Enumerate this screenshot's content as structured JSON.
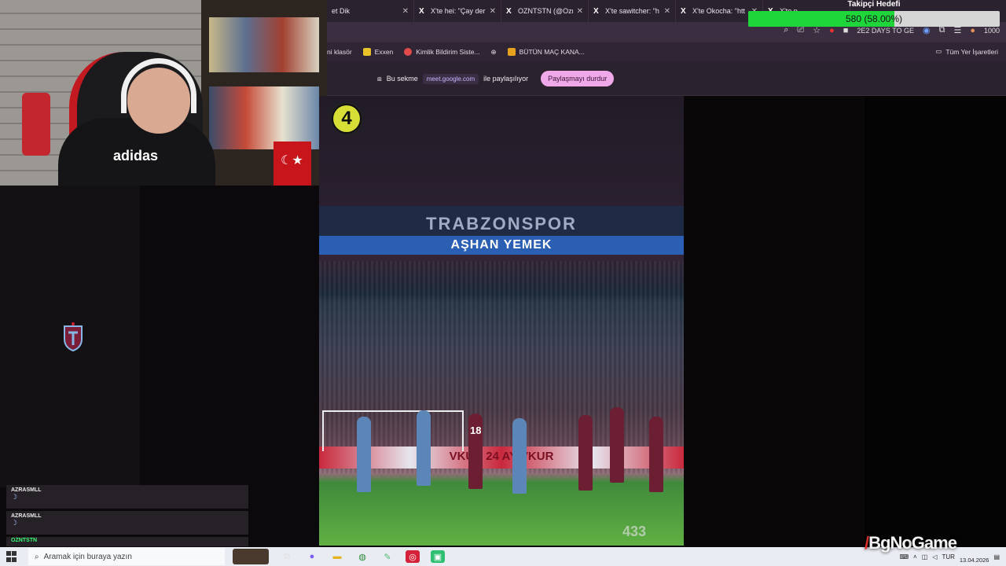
{
  "tabs": [
    {
      "label": "et Dik"
    },
    {
      "label": "X'te hei: \"Çay der"
    },
    {
      "label": "OZNTSTN (@Ozn"
    },
    {
      "label": "X'te sawitcher: \"h"
    },
    {
      "label": "X'te Okocha: \"htt"
    },
    {
      "label": "X'te p"
    }
  ],
  "toolbar": {
    "extension_text": "2E2 DAYS TO GE",
    "count": "1000"
  },
  "bookmarks": [
    {
      "label": "ni klasör"
    },
    {
      "label": "Exxen"
    },
    {
      "label": "Kimlik Bildirim Siste..."
    },
    {
      "label": ""
    },
    {
      "label": "BÜTÜN MAÇ KANA..."
    }
  ],
  "bookmarks_all": "Tüm Yer İşaretleri",
  "share": {
    "prefix": "Bu sekme",
    "domain": "meet.google.com",
    "suffix": "ile paylaşılıyor",
    "stop_label": "Paylaşmayı durdur"
  },
  "follower_goal": {
    "title": "Takipçi Hedefi",
    "progress_text": "580 (58.00%)",
    "progress_fraction": 0.58
  },
  "webcam": {
    "shirt_logo": "adidas"
  },
  "video": {
    "badge": "4",
    "banner_text": "TRABZONSPOR",
    "ad_text": "AŞHAN YEMEK",
    "board_text": "VKUR  24 AY  VKUR",
    "player_number": "18",
    "watermark": "433"
  },
  "chat": [
    {
      "user": "AZRASMLL",
      "emote": "☽",
      "color": "#e9e9e9"
    },
    {
      "user": "AZRASMLL",
      "emote": "☽",
      "color": "#e9e9e9"
    },
    {
      "user": "OZNTSTN",
      "emote": "",
      "color": "#39ff77"
    }
  ],
  "taskbar": {
    "search_placeholder": "Aramak için buraya yazın",
    "lang": "TUR",
    "date": "13.04.2026"
  },
  "brand": {
    "text_a": "BgNo",
    "text_b": "Game"
  }
}
